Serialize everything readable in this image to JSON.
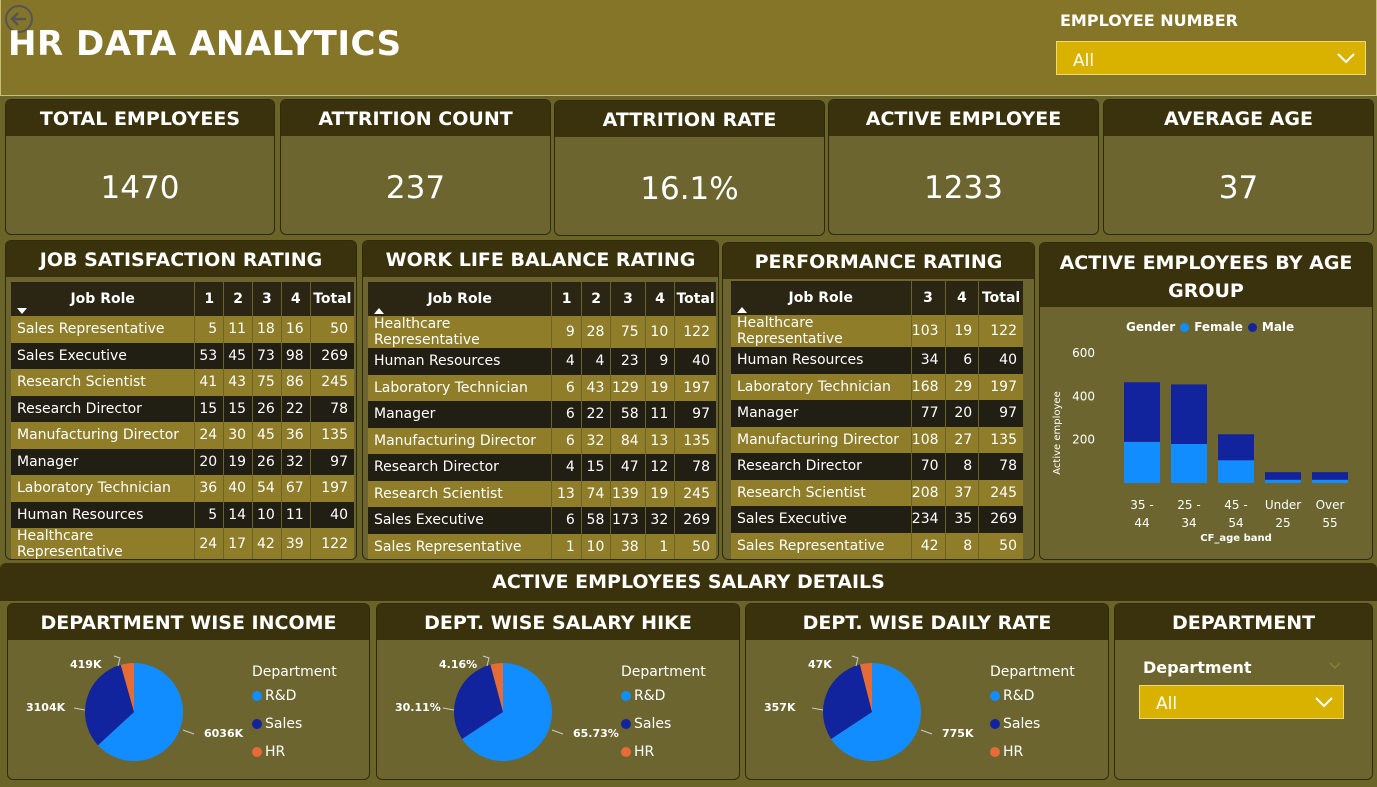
{
  "header": {
    "title": "HR DATA ANALYTICS",
    "filter_label": "EMPLOYEE NUMBER",
    "filter_value": "All"
  },
  "kpis": [
    {
      "label": "TOTAL EMPLOYEES",
      "value": "1470"
    },
    {
      "label": "ATTRITION COUNT",
      "value": "237"
    },
    {
      "label": "ATTRITION RATE",
      "value": "16.1%"
    },
    {
      "label": "ACTIVE EMPLOYEE",
      "value": "1233"
    },
    {
      "label": "AVERAGE AGE",
      "value": "37"
    }
  ],
  "job_satisfaction": {
    "title": "JOB SATISFACTION RATING",
    "columns": [
      "Job Role",
      "1",
      "2",
      "3",
      "4",
      "Total"
    ],
    "rows": [
      [
        "Sales Representative",
        "5",
        "11",
        "18",
        "16",
        "50"
      ],
      [
        "Sales Executive",
        "53",
        "45",
        "73",
        "98",
        "269"
      ],
      [
        "Research Scientist",
        "41",
        "43",
        "75",
        "86",
        "245"
      ],
      [
        "Research Director",
        "15",
        "15",
        "26",
        "22",
        "78"
      ],
      [
        "Manufacturing Director",
        "24",
        "30",
        "45",
        "36",
        "135"
      ],
      [
        "Manager",
        "20",
        "19",
        "26",
        "32",
        "97"
      ],
      [
        "Laboratory Technician",
        "36",
        "40",
        "54",
        "67",
        "197"
      ],
      [
        "Human Resources",
        "5",
        "14",
        "10",
        "11",
        "40"
      ],
      [
        "Healthcare Representative",
        "24",
        "17",
        "42",
        "39",
        "122"
      ]
    ]
  },
  "work_life": {
    "title": "WORK LIFE BALANCE RATING",
    "columns": [
      "Job Role",
      "1",
      "2",
      "3",
      "4",
      "Total"
    ],
    "rows": [
      [
        "Healthcare Representative",
        "9",
        "28",
        "75",
        "10",
        "122"
      ],
      [
        "Human Resources",
        "4",
        "4",
        "23",
        "9",
        "40"
      ],
      [
        "Laboratory Technician",
        "6",
        "43",
        "129",
        "19",
        "197"
      ],
      [
        "Manager",
        "6",
        "22",
        "58",
        "11",
        "97"
      ],
      [
        "Manufacturing Director",
        "6",
        "32",
        "84",
        "13",
        "135"
      ],
      [
        "Research Director",
        "4",
        "15",
        "47",
        "12",
        "78"
      ],
      [
        "Research Scientist",
        "13",
        "74",
        "139",
        "19",
        "245"
      ],
      [
        "Sales Executive",
        "6",
        "58",
        "173",
        "32",
        "269"
      ],
      [
        "Sales Representative",
        "1",
        "10",
        "38",
        "1",
        "50"
      ]
    ]
  },
  "performance": {
    "title": "PERFORMANCE RATING",
    "columns": [
      "Job Role",
      "3",
      "4",
      "Total"
    ],
    "rows": [
      [
        "Healthcare Representative",
        "103",
        "19",
        "122"
      ],
      [
        "Human Resources",
        "34",
        "6",
        "40"
      ],
      [
        "Laboratory Technician",
        "168",
        "29",
        "197"
      ],
      [
        "Manager",
        "77",
        "20",
        "97"
      ],
      [
        "Manufacturing Director",
        "108",
        "27",
        "135"
      ],
      [
        "Research Director",
        "70",
        "8",
        "78"
      ],
      [
        "Research Scientist",
        "208",
        "37",
        "245"
      ],
      [
        "Sales Executive",
        "234",
        "35",
        "269"
      ],
      [
        "Sales Representative",
        "42",
        "8",
        "50"
      ]
    ]
  },
  "age_chart": {
    "title": "ACTIVE EMPLOYEES BY AGE GROUP",
    "legend_title": "Gender",
    "legend": [
      "Female",
      "Male"
    ],
    "colors": {
      "female": "#118dff",
      "male": "#12239e"
    }
  },
  "salary_section": {
    "title": "ACTIVE EMPLOYEES SALARY DETAILS",
    "pies": [
      {
        "title": "DEPARTMENT WISE INCOME",
        "legend_title": "Department",
        "labels": [
          "6036K",
          "3104K",
          "419K"
        ]
      },
      {
        "title": "DEPT. WISE SALARY HIKE",
        "legend_title": "Department",
        "labels": [
          "65.73%",
          "30.11%",
          "4.16%"
        ]
      },
      {
        "title": "DEPT. WISE DAILY RATE",
        "legend_title": "Department",
        "labels": [
          "775K",
          "357K",
          "47K"
        ]
      }
    ],
    "legend": [
      "R&D",
      "Sales",
      "HR"
    ],
    "colors": {
      "rd": "#118dff",
      "sales": "#12239e",
      "hr": "#e66c37"
    },
    "dept_filter": {
      "title": "DEPARTMENT",
      "label": "Department",
      "value": "All"
    }
  },
  "chart_data": [
    {
      "type": "bar",
      "title": "ACTIVE EMPLOYEES BY AGE GROUP",
      "xlabel": "CF_age band",
      "ylabel": "Active employee",
      "categories": [
        "35 - 44",
        "25 - 34",
        "45 - 54",
        "Under 25",
        "Over 55"
      ],
      "series": [
        {
          "name": "Female",
          "values": [
            190,
            180,
            105,
            15,
            15
          ]
        },
        {
          "name": "Male",
          "values": [
            275,
            275,
            120,
            35,
            35
          ]
        }
      ],
      "stacked": true,
      "ylim": [
        0,
        600
      ],
      "yticks": [
        "200",
        "400",
        "600"
      ],
      "legend": "top"
    },
    {
      "type": "pie",
      "title": "DEPARTMENT WISE INCOME",
      "categories": [
        "R&D",
        "Sales",
        "HR"
      ],
      "values": [
        6036,
        3104,
        419
      ]
    },
    {
      "type": "pie",
      "title": "DEPT. WISE SALARY HIKE",
      "categories": [
        "R&D",
        "Sales",
        "HR"
      ],
      "values": [
        65.73,
        30.11,
        4.16
      ]
    },
    {
      "type": "pie",
      "title": "DEPT. WISE DAILY RATE",
      "categories": [
        "R&D",
        "Sales",
        "HR"
      ],
      "values": [
        775,
        357,
        47
      ]
    }
  ]
}
